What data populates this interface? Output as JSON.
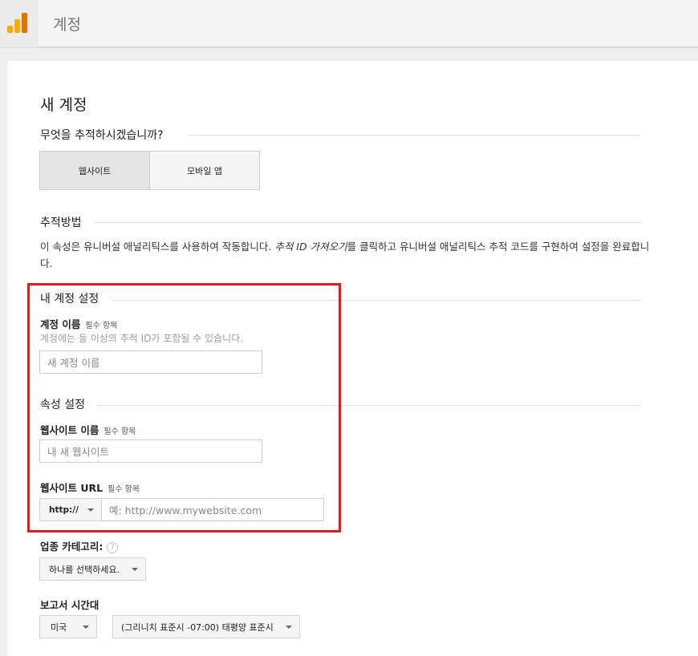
{
  "header": {
    "app_title": "계정"
  },
  "page": {
    "title": "새 계정"
  },
  "tracking_target": {
    "heading": "무엇을 추적하시겠습니까?",
    "options": [
      "웹사이트",
      "모바일 앱"
    ],
    "selected": "웹사이트"
  },
  "tracking_method": {
    "heading": "추적방법",
    "desc_before": "이 속성은 유니버설 애널리틱스를 사용하여 작동합니다. ",
    "desc_em": "추적 ID 가져오기",
    "desc_after": "를 클릭하고 유니버설 애널리틱스 추적 코드를 구현하여 설정을 완료합니다."
  },
  "account_settings": {
    "heading": "내 계정 설정",
    "name_label": "계정 이름",
    "required": "필수 항목",
    "hint": "계정에는 둘 이상의 추적 ID가 포함될 수 있습니다.",
    "name_placeholder": "새 계정 이름"
  },
  "property_settings": {
    "heading": "속성 설정",
    "site_name_label": "웹사이트 이름",
    "site_name_placeholder": "내 새 웹사이트",
    "url_label": "웹사이트 URL",
    "protocol": "http://",
    "url_placeholder": "예: http://www.mywebsite.com"
  },
  "industry": {
    "label": "업종 카테고리:",
    "help": "?",
    "select": "하나를 선택하세요."
  },
  "timezone": {
    "label": "보고서 시간대",
    "country": "미국",
    "zone": "(그리니치 표준시 -07:00) 태평양 표준시"
  },
  "colors": {
    "highlight_border": "#e41b1b",
    "logo_orange": "#f9ab00",
    "logo_dark_orange": "#e37400"
  }
}
